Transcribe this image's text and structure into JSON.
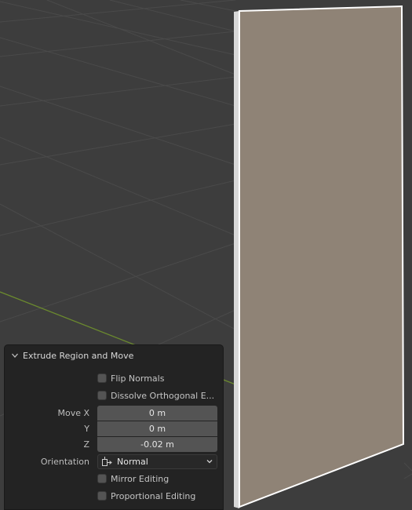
{
  "panel": {
    "title": "Extrude Region and Move",
    "flip_normals": {
      "label": "Flip Normals",
      "checked": false
    },
    "dissolve_orthogonal": {
      "label": "Dissolve Orthogonal E...",
      "checked": false
    },
    "move": {
      "x_label": "Move X",
      "y_label": "Y",
      "z_label": "Z",
      "x_value": "0 m",
      "y_value": "0 m",
      "z_value": "-0.02 m"
    },
    "orientation": {
      "label": "Orientation",
      "value": "Normal"
    },
    "mirror_editing": {
      "label": "Mirror Editing",
      "checked": false
    },
    "proportional_editing": {
      "label": "Proportional Editing",
      "checked": false
    }
  },
  "icons": {
    "panel_collapse": "chevron-down-icon",
    "orientation": "orientation-normal-icon",
    "dropdown": "dropdown-arrow-icon"
  },
  "colors": {
    "viewport_bg": "#3d3d3d",
    "grid_line": "#4a4a4a",
    "x_axis_line": "#6b8a2e",
    "plane_face": "#8f8376",
    "plane_edge": "#ffffff",
    "panel_bg": "#232323",
    "field_bg": "#545454"
  }
}
